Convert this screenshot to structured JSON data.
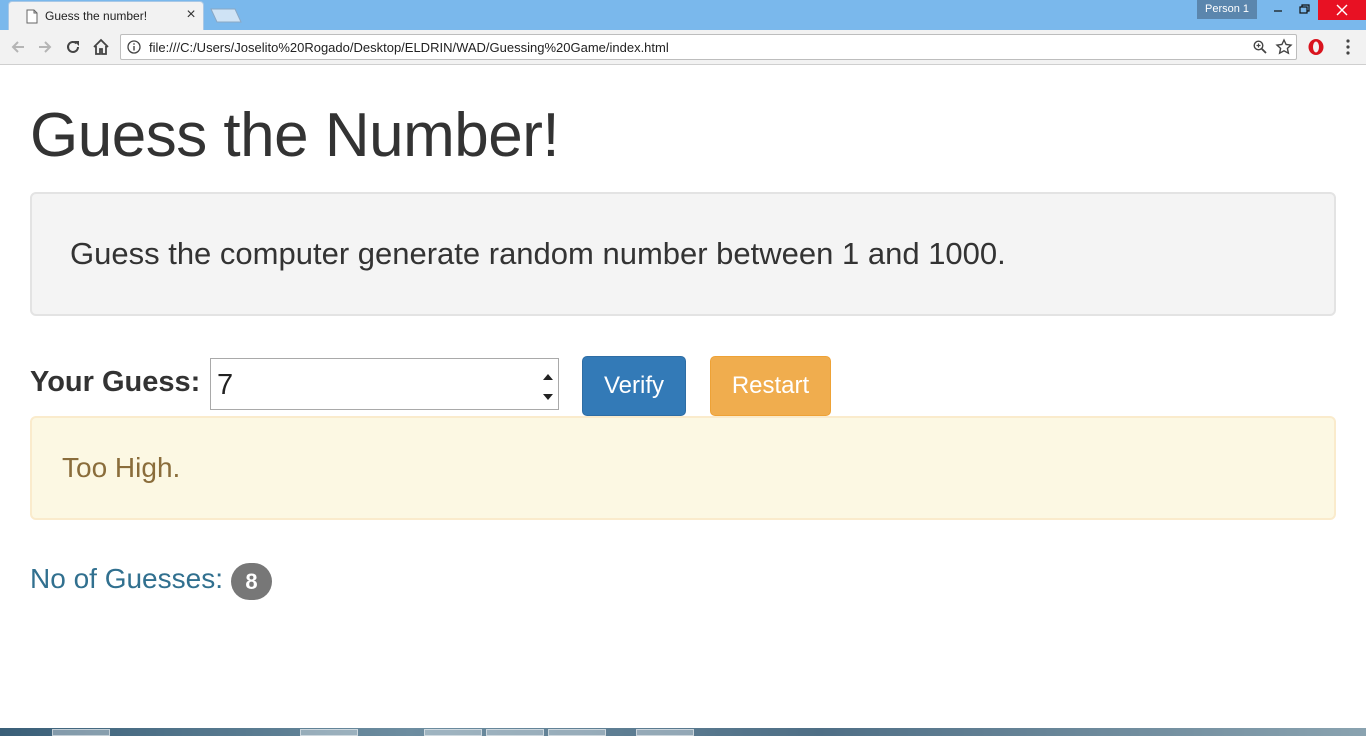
{
  "browser": {
    "tab_title": "Guess the number!",
    "profile_label": "Person 1",
    "url": "file:///C:/Users/Joselito%20Rogado/Desktop/ELDRIN/WAD/Guessing%20Game/index.html"
  },
  "page": {
    "title": "Guess the Number!",
    "instructions": "Guess the computer generate random number between 1 and 1000.",
    "guess_label": "Your Guess:",
    "guess_value": "7",
    "verify_label": "Verify",
    "restart_label": "Restart",
    "feedback": "Too High.",
    "guess_count_label": "No of Guesses:",
    "guess_count": "8"
  },
  "colors": {
    "verify": "#337ab7",
    "restart": "#f0ad4e",
    "alert_bg": "#fcf8e3",
    "alert_text": "#8a6d3b",
    "count_label": "#31708f",
    "badge": "#777777"
  },
  "icons": {
    "tab": "page-icon",
    "tab_close": "close-icon",
    "back": "back-arrow-icon",
    "forward": "forward-arrow-icon",
    "reload": "reload-icon",
    "home": "home-icon",
    "site_info": "info-icon",
    "zoom": "zoom-icon",
    "bookmark": "star-icon",
    "extension": "opera-icon",
    "menu": "menu-icon"
  }
}
